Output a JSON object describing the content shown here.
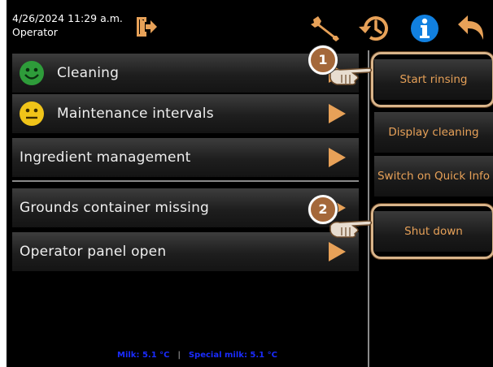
{
  "header": {
    "datetime": "4/26/2024 11:29 a.m.",
    "user": "Operator",
    "icons": [
      "logout-icon",
      "wrench-icon",
      "history-icon",
      "info-icon",
      "back-arrow-icon"
    ]
  },
  "main_list": {
    "items": [
      {
        "label": "Cleaning",
        "status_icon": "smiley-green-icon"
      },
      {
        "label": "Maintenance intervals",
        "status_icon": "smiley-yellow-icon"
      },
      {
        "label": "Ingredient management"
      },
      {
        "label": "Grounds container missing"
      },
      {
        "label": "Operator panel open"
      }
    ]
  },
  "side_menu": {
    "buttons": [
      {
        "label": "Start rinsing",
        "callout": "1"
      },
      {
        "label": "Display cleaning"
      },
      {
        "label": "Switch on Quick Info"
      },
      {
        "label": "Shut down",
        "callout": "2"
      }
    ]
  },
  "status_bar": {
    "milk": "Milk: 5.1 °C",
    "separator": "|",
    "special_milk": "Special milk: 5.1 °C"
  },
  "colors": {
    "accent": "#e7a158",
    "background": "#000000",
    "status_text": "#1a2cff",
    "info_icon": "#1180e0",
    "smiley_green": "#2e9c3a",
    "smiley_yellow": "#f0c419"
  }
}
